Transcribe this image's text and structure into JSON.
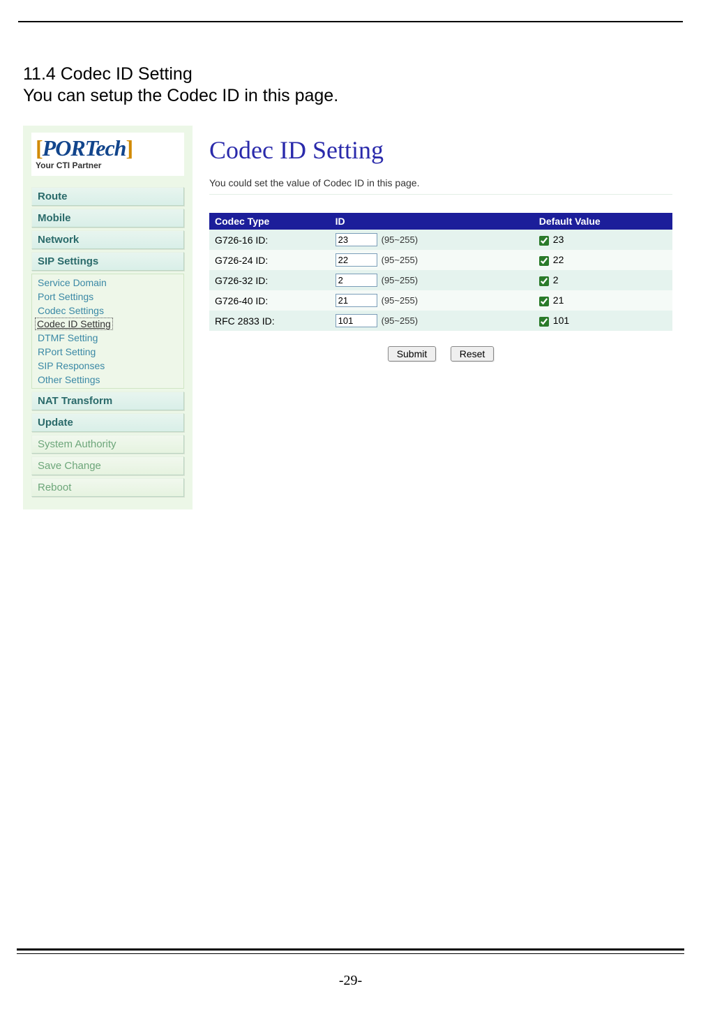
{
  "doc": {
    "heading": "11.4  Codec ID Setting",
    "description": "You can setup the Codec ID in this page.",
    "page_number": "-29-"
  },
  "logo": {
    "brand": "PORTech",
    "sub": "Your CTI Partner"
  },
  "sidebar": {
    "items": [
      {
        "label": "Route",
        "type": "main"
      },
      {
        "label": "Mobile",
        "type": "main"
      },
      {
        "label": "Network",
        "type": "main"
      },
      {
        "label": "SIP Settings",
        "type": "main"
      },
      {
        "label": "NAT Transform",
        "type": "main"
      },
      {
        "label": "Update",
        "type": "main"
      },
      {
        "label": "System Authority",
        "type": "light"
      },
      {
        "label": "Save Change",
        "type": "light"
      },
      {
        "label": "Reboot",
        "type": "light"
      }
    ],
    "sip_sub": [
      "Service Domain",
      "Port Settings",
      "Codec Settings",
      "Codec ID Setting",
      "DTMF Setting",
      "RPort Setting",
      "SIP Responses",
      "Other Settings"
    ],
    "sip_current_index": 3
  },
  "main": {
    "title": "Codec ID Setting",
    "intro": "You could set the value of Codec ID in this page.",
    "columns": {
      "c0": "Codec Type",
      "c1": "ID",
      "c2": "Default Value"
    },
    "range_hint": "(95~255)",
    "rows": [
      {
        "type": "G726-16 ID:",
        "id": "23",
        "default": "23",
        "checked": true
      },
      {
        "type": "G726-24 ID:",
        "id": "22",
        "default": "22",
        "checked": true
      },
      {
        "type": "G726-32 ID:",
        "id": "2",
        "default": "2",
        "checked": true
      },
      {
        "type": "G726-40 ID:",
        "id": "21",
        "default": "21",
        "checked": true
      },
      {
        "type": "RFC 2833 ID:",
        "id": "101",
        "default": "101",
        "checked": true
      }
    ],
    "buttons": {
      "submit": "Submit",
      "reset": "Reset"
    }
  }
}
